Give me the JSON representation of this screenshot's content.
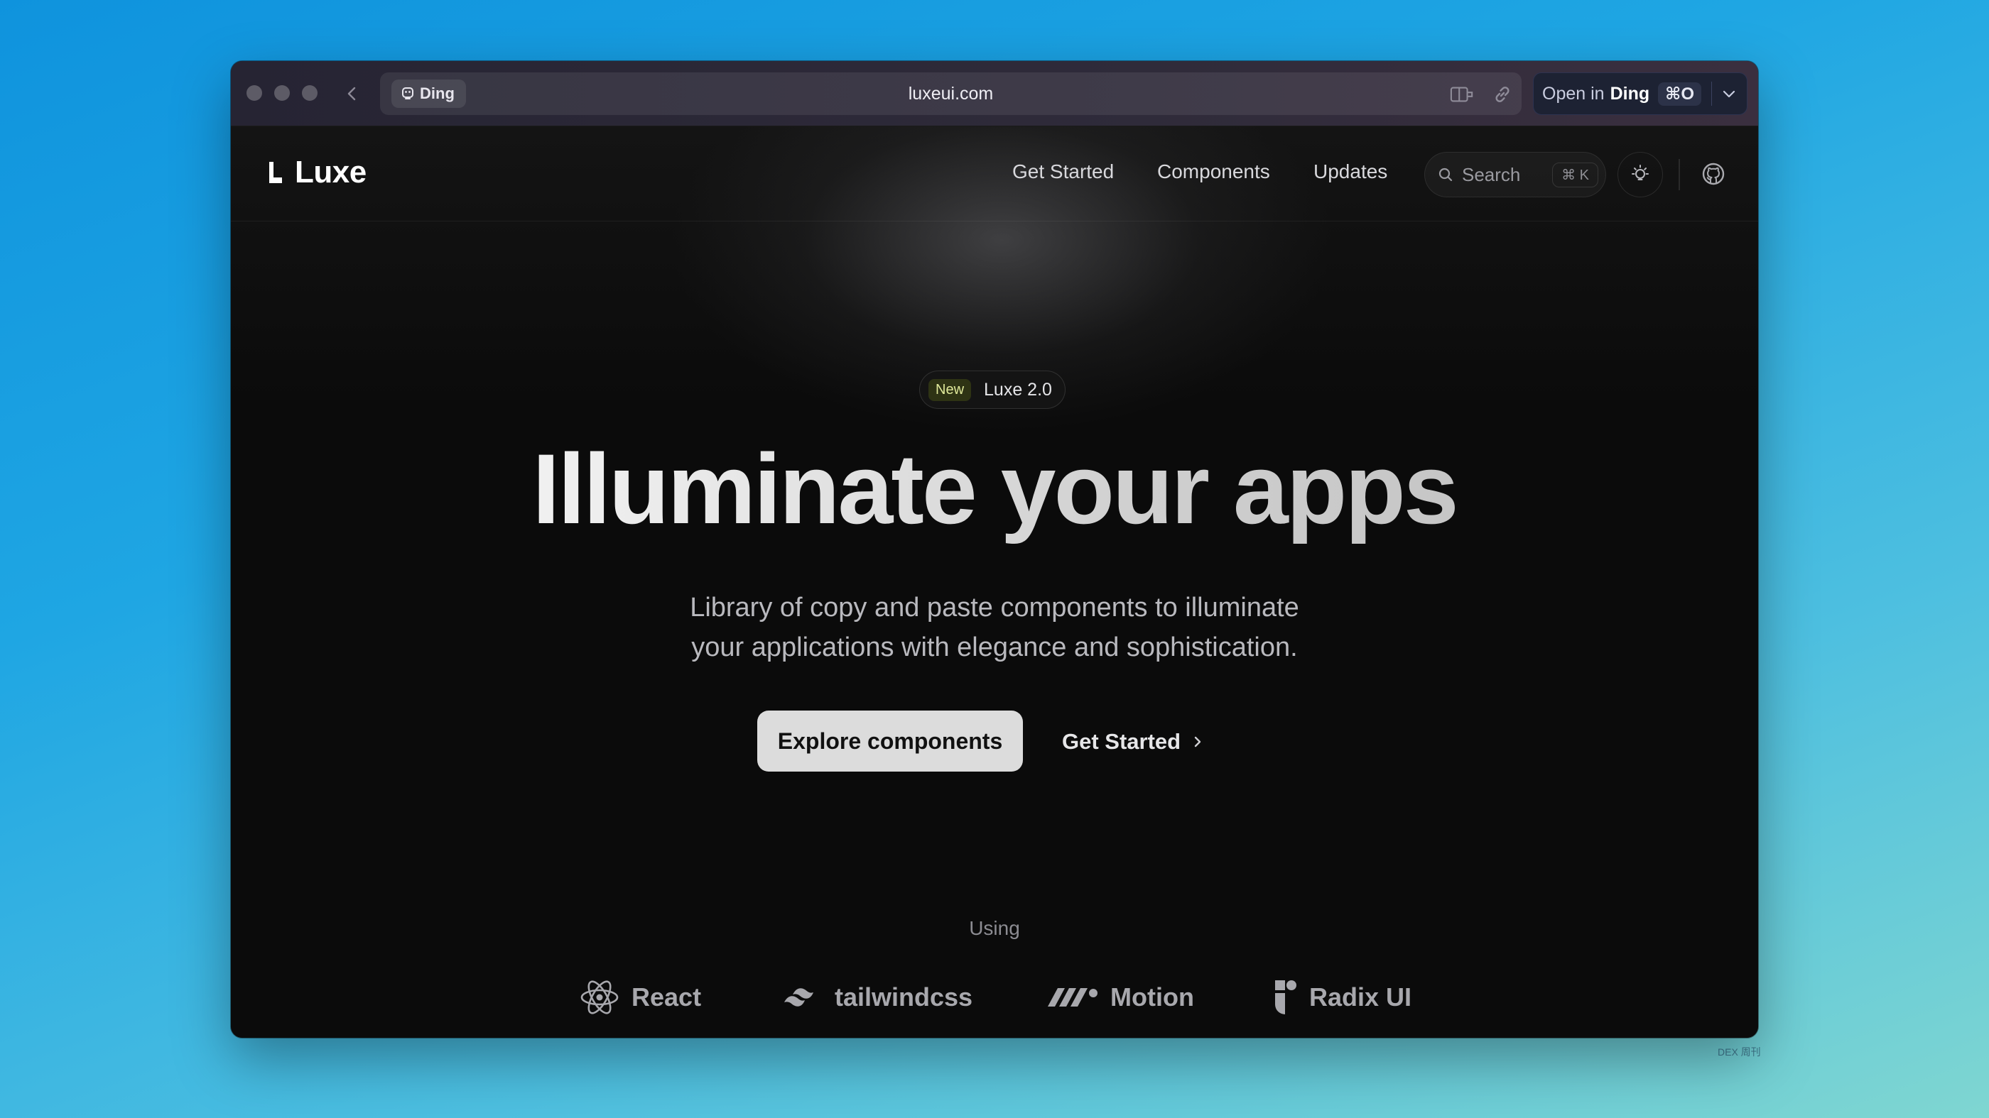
{
  "browser": {
    "site_chip": "Ding",
    "url": "luxeui.com",
    "open_in": {
      "prefix": "Open in",
      "app": "Ding",
      "shortcut": "⌘O"
    }
  },
  "nav": {
    "logo": "Luxe",
    "links": [
      "Get Started",
      "Components",
      "Updates"
    ],
    "search_placeholder": "Search",
    "search_shortcut": "⌘ K"
  },
  "hero": {
    "badge_new": "New",
    "badge_text": "Luxe 2.0",
    "headline": "Illuminate your apps",
    "subtitle_line1": "Library of copy and paste components to illuminate",
    "subtitle_line2": "your applications with elegance and sophistication.",
    "primary_button": "Explore components",
    "secondary_button": "Get Started"
  },
  "using": {
    "label": "Using",
    "items": [
      {
        "name": "React",
        "icon": "react-icon"
      },
      {
        "name": "tailwindcss",
        "icon": "tailwind-icon"
      },
      {
        "name": "Motion",
        "icon": "motion-icon"
      },
      {
        "name": "Radix UI",
        "icon": "radix-icon"
      }
    ]
  },
  "watermark": "DEX 周刊",
  "colors": {
    "desktop_top": "#0f93dd",
    "desktop_bottom": "#7fd6d1",
    "page_bg": "#0b0b0b",
    "primary_button_bg": "#dcdcdc",
    "badge_new_bg": "#2e3314"
  }
}
